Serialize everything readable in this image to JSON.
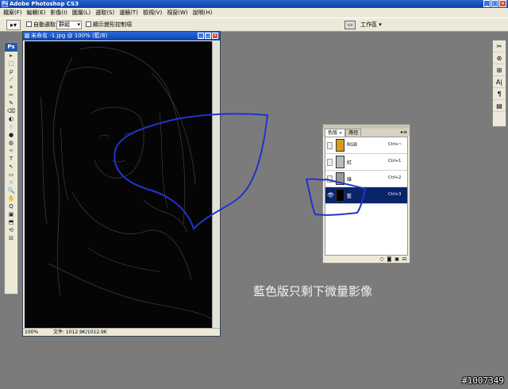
{
  "app": {
    "title": "Adobe Photoshop CS3",
    "icon": "ps-icon",
    "window_buttons": [
      "_",
      "□",
      "×"
    ]
  },
  "menu": [
    "檔案(F)",
    "編輯(E)",
    "影像(I)",
    "圖層(L)",
    "選取(S)",
    "濾鏡(T)",
    "檢視(V)",
    "視窗(W)",
    "說明(H)"
  ],
  "options": {
    "auto_select_label": "自動選取:",
    "auto_select_value": "群組",
    "show_transform_label": "顯示變形控制項",
    "workspace_label": "工作區 ▾"
  },
  "toolbox": {
    "logo": "Ps",
    "tools": [
      "▸",
      "⬚",
      "ρ",
      "⟋",
      "⌗",
      "✂",
      "✎",
      "⌫",
      "◐",
      "♢",
      "●",
      "◍",
      "✧",
      "T",
      "↖",
      "▭",
      "☝",
      "🔍",
      "✋",
      "Q",
      "▣",
      "⬒",
      "⟲",
      "⊟"
    ]
  },
  "right_dock": {
    "icons": [
      "✂",
      "⊛",
      "⊞",
      "A|",
      "¶",
      "▤"
    ]
  },
  "document": {
    "title": "未命名 -1.jpg @ 100% (藍/8)",
    "zoom": "100%",
    "file_info": "文件: 1012.9K/1012.9K"
  },
  "channels_palette": {
    "tabs": [
      {
        "label": "色版",
        "active": true
      },
      {
        "label": "路徑",
        "active": false
      }
    ],
    "channels": [
      {
        "name": "RGB",
        "shortcut": "Ctrl+~",
        "visible": false,
        "selected": false
      },
      {
        "name": "紅",
        "shortcut": "Ctrl+1",
        "visible": false,
        "selected": false
      },
      {
        "name": "綠",
        "shortcut": "Ctrl+2",
        "visible": false,
        "selected": false
      },
      {
        "name": "藍",
        "shortcut": "Ctrl+3",
        "visible": true,
        "selected": true
      }
    ],
    "bottom_icons": [
      "○",
      "◙",
      "▣",
      "⊟"
    ]
  },
  "caption": "藍色版只剩下微量影像",
  "watermark": "#1007349",
  "colors": {
    "annotation_stroke": "#2233cc",
    "selected_row": "#0a246a",
    "titlebar": "#0a3fa8"
  }
}
